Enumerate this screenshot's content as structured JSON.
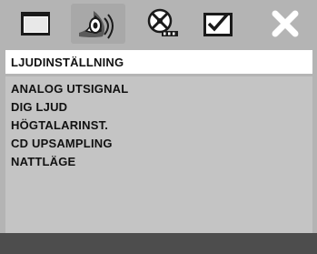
{
  "toolbar": {
    "icons": [
      {
        "name": "general-setup-icon"
      },
      {
        "name": "audio-setup-icon"
      },
      {
        "name": "video-setup-icon"
      },
      {
        "name": "preferences-icon"
      },
      {
        "name": "exit-icon"
      }
    ]
  },
  "page": {
    "title": "LJUDINSTÄLLNING"
  },
  "menu": {
    "items": [
      {
        "label": "ANALOG UTSIGNAL"
      },
      {
        "label": "DIG LJUD"
      },
      {
        "label": "HÖGTALARINST."
      },
      {
        "label": "CD UPSAMPLING"
      },
      {
        "label": "NATTLÄGE"
      }
    ]
  },
  "colors": {
    "panel": "#b4b4b4",
    "menu_bg": "#c4c4c4",
    "title_bg": "#ffffff",
    "bottom_bar": "#4d4d4d",
    "text": "#111111"
  }
}
